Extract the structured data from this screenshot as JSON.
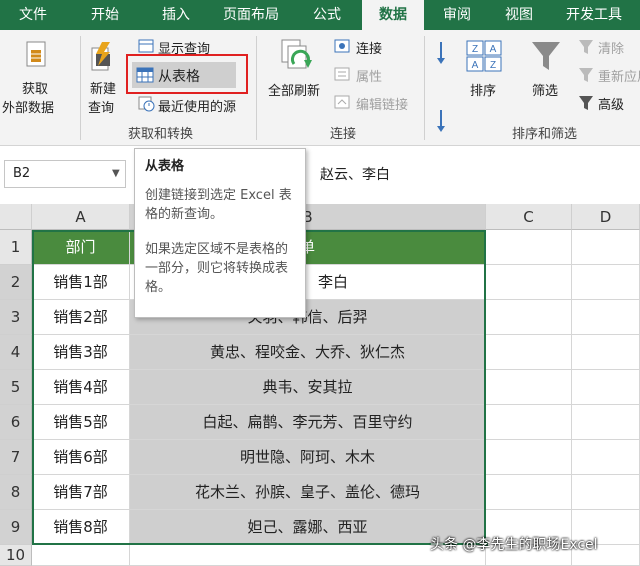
{
  "tabs": [
    "文件",
    "开始",
    "插入",
    "页面布局",
    "公式",
    "数据",
    "审阅",
    "视图",
    "开发工具"
  ],
  "ribbon": {
    "get_external": [
      "获取",
      "外部数据"
    ],
    "new_query": [
      "新建",
      "查询"
    ],
    "show_query": "显示查询",
    "from_table": "从表格",
    "recent_sources": "最近使用的源",
    "group_get_transform": "获取和转换",
    "refresh_all": "全部刷新",
    "connections": "连接",
    "properties": "属性",
    "edit_links": "编辑链接",
    "group_connections": "连接",
    "sort": "排序",
    "filter": "筛选",
    "clear": "清除",
    "reapply": "重新应用",
    "advanced": "高级",
    "group_sort_filter": "排序和筛选",
    "sort_icon_letters": [
      "Z",
      "A",
      "A",
      "Z"
    ],
    "accent": "#217346",
    "highlight_box": "#e02020"
  },
  "formula_bar": {
    "name_box": "B2",
    "fx": "fx",
    "value": "赵云、李白"
  },
  "tooltip": {
    "title": "从表格",
    "line1": "创建链接到选定 Excel 表格的新查询。",
    "line2": "如果选定区域不是表格的一部分，则它将转换成表格。"
  },
  "grid": {
    "columns": [
      "A",
      "B",
      "C",
      "D"
    ],
    "rows": [
      "1",
      "2",
      "3",
      "4",
      "5",
      "6",
      "7",
      "8",
      "9",
      "10"
    ],
    "header": [
      "部门",
      "单"
    ],
    "data": [
      [
        "销售1部",
        "李白"
      ],
      [
        "销售2部",
        "关羽、韩信、后羿"
      ],
      [
        "销售3部",
        "黄忠、程咬金、大乔、狄仁杰"
      ],
      [
        "销售4部",
        "典韦、安其拉"
      ],
      [
        "销售5部",
        "白起、扁鹊、李元芳、百里守约"
      ],
      [
        "销售6部",
        "明世隐、阿珂、木木"
      ],
      [
        "销售7部",
        "花木兰、孙膑、皇子、盖伦、德玛"
      ],
      [
        "销售8部",
        "妲己、露娜、西亚"
      ]
    ]
  },
  "watermark": "头条 @李先生的职场Excel"
}
